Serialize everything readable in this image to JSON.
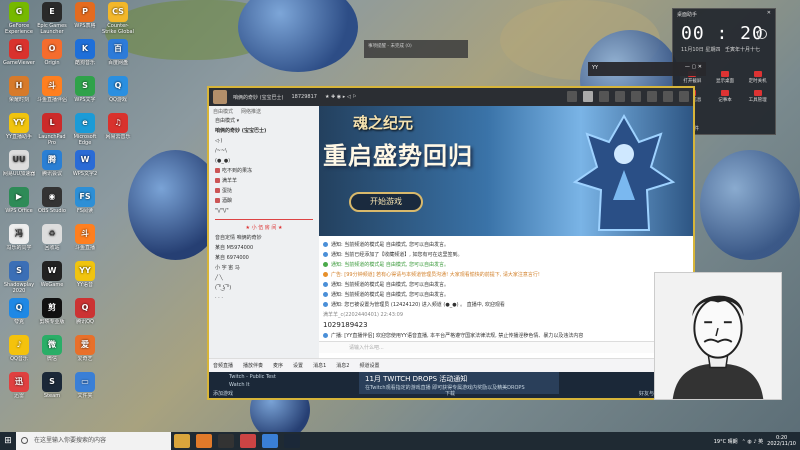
{
  "desktop_icons": [
    {
      "label": "GeForce Experience",
      "color": "#76b900",
      "glyph": "G"
    },
    {
      "label": "GameViewer",
      "color": "#d9322d",
      "glyph": "G"
    },
    {
      "label": "荣耀时刻",
      "color": "#d77a2a",
      "glyph": "H"
    },
    {
      "label": "YY直播助手",
      "color": "#f1c40f",
      "glyph": "YY"
    },
    {
      "label": "网易UU加速器",
      "color": "#dddddd",
      "glyph": "UU"
    },
    {
      "label": "WPS Office",
      "color": "#2e8b57",
      "glyph": "▶"
    },
    {
      "label": "冯乐的同学",
      "color": "#eeeeee",
      "glyph": "冯"
    },
    {
      "label": "Shadowplay 2020",
      "color": "#3b6fb6",
      "glyph": "S"
    },
    {
      "label": "夸克",
      "color": "#1e88e5",
      "glyph": "Q"
    },
    {
      "label": "QQ音乐",
      "color": "#f4c20d",
      "glyph": "♪"
    },
    {
      "label": "迅雷",
      "color": "#e04040",
      "glyph": "迅"
    },
    {
      "label": "Epic Games Launcher",
      "color": "#2a2a2a",
      "glyph": "E"
    },
    {
      "label": "Origin",
      "color": "#f56c2d",
      "glyph": "O"
    },
    {
      "label": "斗鱼直播伴侣",
      "color": "#ff7f1f",
      "glyph": "斗"
    },
    {
      "label": "LaunchPad Pro",
      "color": "#cc2a2a",
      "glyph": "L"
    },
    {
      "label": "腾讯会议",
      "color": "#2a7fd4",
      "glyph": "腾"
    },
    {
      "label": "OBS Studio",
      "color": "#333333",
      "glyph": "◉"
    },
    {
      "label": "回收站",
      "color": "#dddddd",
      "glyph": "♻"
    },
    {
      "label": "WeGame",
      "color": "#222222",
      "glyph": "W"
    },
    {
      "label": "剪映专业版",
      "color": "#111111",
      "glyph": "剪"
    },
    {
      "label": "微信",
      "color": "#2aae67",
      "glyph": "微"
    },
    {
      "label": "Steam",
      "color": "#1b2838",
      "glyph": "S"
    },
    {
      "label": "WPS表格",
      "color": "#e46b1f",
      "glyph": "P"
    },
    {
      "label": "酷狗音乐",
      "color": "#1e6fd9",
      "glyph": "K"
    },
    {
      "label": "WPS文字",
      "color": "#2fa24a",
      "glyph": "S"
    },
    {
      "label": "Microsoft Edge",
      "color": "#1b9bd7",
      "glyph": "e"
    },
    {
      "label": "WPS文字2",
      "color": "#2a6bd6",
      "glyph": "W"
    },
    {
      "label": "FS阅读",
      "color": "#2d8fd6",
      "glyph": "FS"
    },
    {
      "label": "斗鱼直播",
      "color": "#ff7f1f",
      "glyph": "斗"
    },
    {
      "label": "YY语音",
      "color": "#f1c40f",
      "glyph": "YY"
    },
    {
      "label": "腾讯QQ",
      "color": "#cc3333",
      "glyph": "Q"
    },
    {
      "label": "爱奇艺",
      "color": "#e8702a",
      "glyph": "爱"
    },
    {
      "label": "文件夹",
      "color": "#3a7fd6",
      "glyph": "▭"
    },
    {
      "label": "Counter-Strike Global",
      "color": "#f3b72a",
      "glyph": "CS"
    },
    {
      "label": "百度网盘",
      "color": "#2d7bd9",
      "glyph": "百"
    },
    {
      "label": "QQ游戏",
      "color": "#2a8fe0",
      "glyph": "Q"
    },
    {
      "label": "网易云音乐",
      "color": "#d9322d",
      "glyph": "♫"
    }
  ],
  "taskbar": {
    "search_placeholder": "在这里输入你要搜索的内容",
    "weather": "19°C 晴朗",
    "time": "0:20",
    "date": "2022/11/10"
  },
  "clock_widget": {
    "title": "桌面助手",
    "time": "00 : 20",
    "date": "11月10日  星期四",
    "lunar": "壬寅年十月十七",
    "items": [
      "打开截屏",
      "显示桌面",
      "定时关机",
      "系统信息",
      "记事本",
      "工具管理"
    ],
    "footer": "桌面文件"
  },
  "note_window": {
    "title": "事项提醒 - 未完成 (0)"
  },
  "yy_bar": {
    "title": "YY"
  },
  "stream_window": {
    "title": "咱俩的奇妙 (宝宝巴士)",
    "room_id": "18729817",
    "tabs": [
      "房间",
      "设置"
    ],
    "left_panel": {
      "tabs": [
        "自由模式",
        "网络推送"
      ],
      "mode_label": "自由模式 ▾",
      "channel_name": "咱俩的奇妙 (宝宝巴士)",
      "members": [
        "◁·)",
        "/~~\\",
        "(●_●)",
        "吃不到的果冻",
        "满羊羊",
        "蛋挞",
        "酒酿",
        "\"\\/\"\\/\"",
        "★ 小 伍 房 间 ★",
        "音自定情  咱俩的奇妙",
        "某自  M5974000",
        "某自  6974000",
        "小 宇 宙 马",
        "╱ ╲",
        "( ͡° ͜ʖ ͡°)",
        "·  ·  ·"
      ]
    },
    "banner": {
      "game_title": "魂之纪元",
      "slogan": "重启盛势回归",
      "play_button": "开始游戏"
    },
    "chat": [
      {
        "type": "sys",
        "text": "通知: 当前频道的模式是 自由模式, 您可以自由发言。"
      },
      {
        "type": "sys",
        "text": "通知: 当前已经添加了【收藏频道】, 如您有可在这里签到。"
      },
      {
        "type": "green",
        "text": "通知: 当前频道的模式是 自由模式, 您可以自由发言。"
      },
      {
        "type": "orange",
        "text": "广告: [99分钟频道] 若有心得请与本频道管理员沟通! 大家观看愉快的前提下, 请大家注意言行!"
      },
      {
        "type": "sys",
        "text": "通知: 当前频道的模式是 自由模式, 您可以自由发言。"
      },
      {
        "type": "sys",
        "text": "通知: 当前频道的模式是 自由模式, 您可以自由发言。"
      },
      {
        "type": "sys",
        "text": "通知: 您已被设置为管理员 (12424120) 进入频道 (●_●) 。  直播中, 欢迎观看"
      },
      {
        "type": "user",
        "text": "满羊羊_c(2202440401)  22:43:09"
      },
      {
        "type": "num",
        "text": "1029189423"
      },
      {
        "type": "sys",
        "text": "广播: [YY直播伴侣] 欢迎您使用YY语音直播, 本平台严格遵守国家法律法规, 禁止传播淫秽色情、暴力以及违法内容"
      }
    ],
    "input_placeholder": "请输入什么吧...",
    "bottom_bar": [
      "音频直播",
      "播放伴奏",
      "麦序",
      "设置",
      "消息1",
      "消息2",
      "频道设置"
    ],
    "steam": {
      "item1": "Twitch - Public Test",
      "item2": "Watch It",
      "drops_title": "11月 TWITCH DROPS 活动通知",
      "drops_sub": "在Twitch观看指定的游戏直播 即可获得专属游戏内奖励以及精美DROPS",
      "footer_left": "添加游戏",
      "footer_mid": "下载",
      "footer_right": "好友与聊天"
    }
  }
}
